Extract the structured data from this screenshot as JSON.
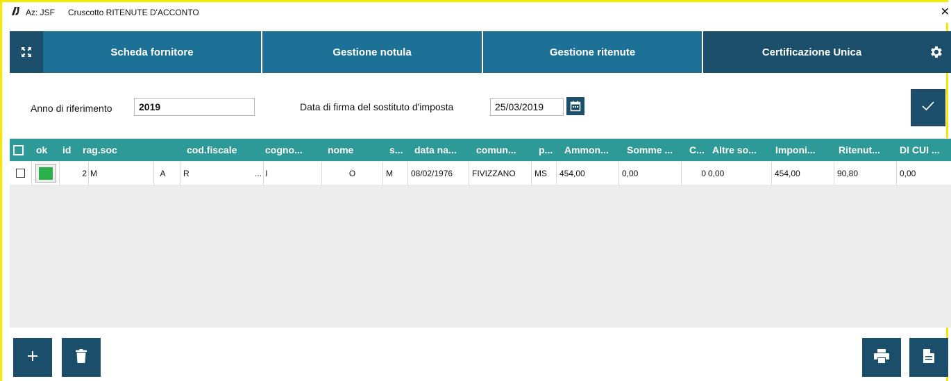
{
  "window": {
    "az_label": "Az: JSF",
    "title": "Cruscotto RITENUTE D'ACCONTO",
    "close_glyph": "✕",
    "border_color": "#f5e800"
  },
  "nav": {
    "tabs": [
      {
        "label": "Scheda fornitore",
        "active": false
      },
      {
        "label": "Gestione notula",
        "active": false
      },
      {
        "label": "Gestione ritenute",
        "active": false
      },
      {
        "label": "Certificazione Unica",
        "active": true
      }
    ],
    "expand_icon": "expand-icon",
    "settings_icon": "gear-icon",
    "color": "#1e7196",
    "active_color": "#1a4e6b"
  },
  "form": {
    "anno_label": "Anno di riferimento",
    "anno_value": "2019",
    "data_label": "Data di firma del sostituto d'imposta",
    "data_value": "25/03/2019"
  },
  "table": {
    "header_color": "#2e9a98",
    "columns": [
      "ok",
      "id",
      "rag.soc",
      "cod.fiscale",
      "cogno...",
      "nome",
      "s...",
      "data na...",
      "comun...",
      "p...",
      "Ammon...",
      "Somme ...",
      "C...",
      "Altre so...",
      "Imponi...",
      "Ritenut...",
      "DI CUI ..."
    ],
    "rows": [
      {
        "id": "2",
        "rag_soc": "M",
        "rag_soc_end": "A",
        "cod_fiscale": "R",
        "cod_fiscale_end": "...",
        "cognome": "I",
        "nome": "O",
        "sesso": "M",
        "data_nascita": "08/02/1976",
        "comune": "FIVIZZANO",
        "provincia": "MS",
        "ammontare": "454,00",
        "somme": "0,00",
        "c": "0",
        "altre_somme": "0,00",
        "imponibile": "454,00",
        "ritenuta": "90,80",
        "di_cui": "0,00",
        "ok_color": "#2ab14c"
      }
    ]
  },
  "actions": {
    "add_icon": "plus-icon",
    "delete_icon": "trash-icon",
    "print_icon": "printer-icon",
    "document_icon": "document-icon"
  }
}
